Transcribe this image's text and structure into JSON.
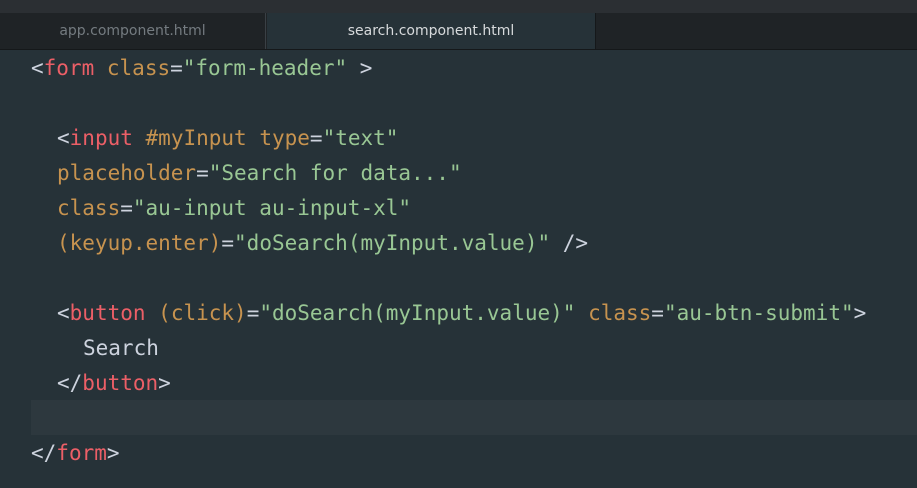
{
  "tabs": [
    {
      "label": "app.component.html",
      "active": false
    },
    {
      "label": "search.component.html",
      "active": true
    }
  ],
  "code": {
    "l1": {
      "lt": "<",
      "tag": "form",
      "attr": "class",
      "eq": "=",
      "val": "\"form-header\"",
      "end": " >"
    },
    "l3": {
      "lt": "<",
      "tag": "input",
      "attr1": "#myInput",
      "attr2": "type",
      "eq": "=",
      "val": "\"text\""
    },
    "l4": {
      "attr": "placeholder",
      "eq": "=",
      "val": "\"Search for data...\""
    },
    "l5": {
      "attr": "class",
      "eq": "=",
      "val": "\"au-input au-input-xl\""
    },
    "l6": {
      "attr": "(keyup.enter)",
      "eq": "=",
      "val": "\"doSearch(myInput.value)\"",
      "end": " />"
    },
    "l8": {
      "lt": "<",
      "tag": "button",
      "attr1": "(click)",
      "eq1": "=",
      "val1": "\"doSearch(myInput.value)\"",
      "attr2": "class",
      "eq2": "=",
      "val2": "\"au-btn-submit\"",
      "end": ">"
    },
    "l9": {
      "text": "Search"
    },
    "l10": {
      "lt": "</",
      "tag": "button",
      "end": ">"
    },
    "l12": {
      "lt": "</",
      "tag": "form",
      "end": ">"
    }
  },
  "colors": {
    "background": "#263238",
    "tag": "#ec5f67",
    "attribute": "#c7934f",
    "string": "#99c794",
    "punctuation": "#cdd3de"
  }
}
